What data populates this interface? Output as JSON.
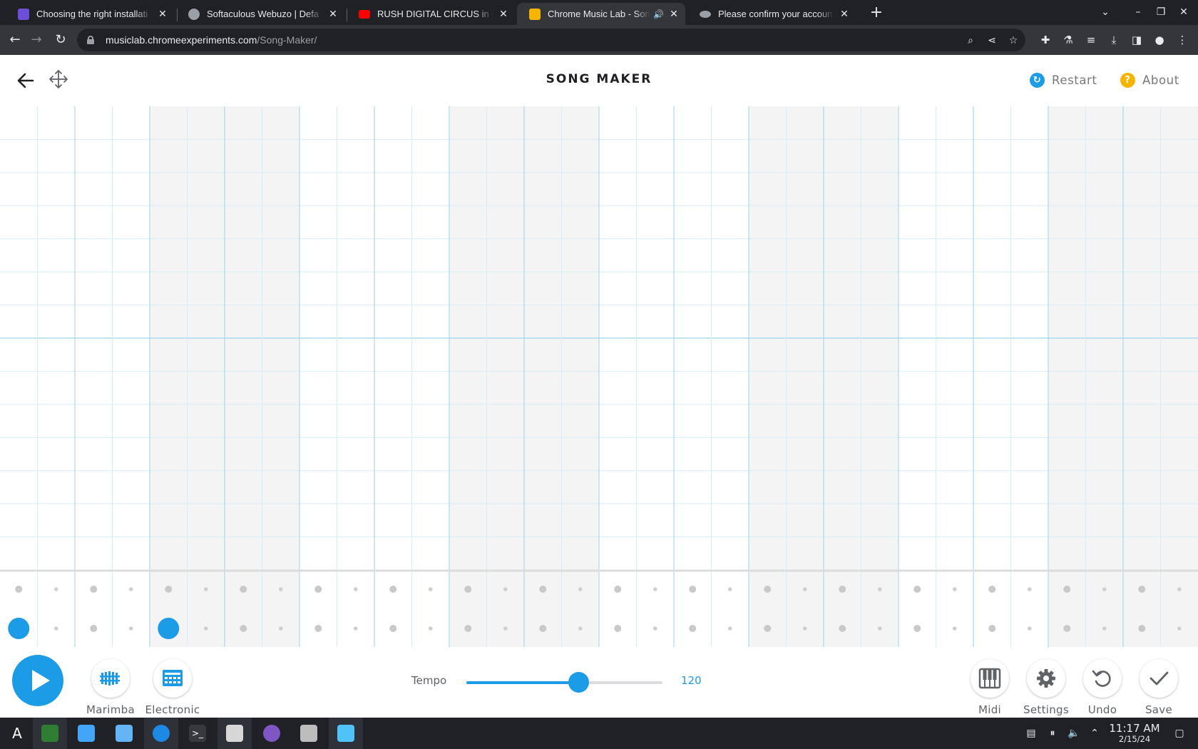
{
  "browser": {
    "tabs": [
      {
        "title": "Choosing the right installati",
        "favicon_color": "#6b4fd8",
        "active": false
      },
      {
        "title": "Softaculous Webuzo | Defa",
        "favicon_color": "#9aa0a6",
        "active": false
      },
      {
        "title": "RUSH DIGITAL CIRCUS in ch",
        "favicon_color": "#ff0000",
        "active": false
      },
      {
        "title": "Chrome Music Lab - Son",
        "favicon_color": "#f4b400",
        "active": true
      },
      {
        "title": "Please confirm your accoun",
        "favicon_color": "#9aa0a6",
        "active": false
      }
    ],
    "url_host": "musiclab.chromeexperiments.com",
    "url_path": "/Song-Maker/"
  },
  "app": {
    "title": "SONG MAKER",
    "restart_label": "Restart",
    "about_label": "About",
    "restart_color": "#1c9be6",
    "about_color": "#f4b400"
  },
  "grid": {
    "columns": 32,
    "melody_rows": 14,
    "percussion_rows": 2,
    "active_notes": [
      {
        "row": "percussion-2",
        "column": 1
      },
      {
        "row": "percussion-2",
        "column": 5
      }
    ],
    "note_color": "#1c9be6"
  },
  "controls": {
    "play_label": "Play",
    "instruments": [
      {
        "name": "Marimba"
      },
      {
        "name": "Electronic"
      }
    ],
    "tempo_label": "Tempo",
    "tempo_value": "120",
    "tempo_fraction": 0.57,
    "right_buttons": [
      {
        "name": "Midi"
      },
      {
        "name": "Settings"
      },
      {
        "name": "Undo"
      },
      {
        "name": "Save"
      }
    ]
  },
  "taskbar": {
    "time": "11:17 AM",
    "date": "2/15/24"
  }
}
